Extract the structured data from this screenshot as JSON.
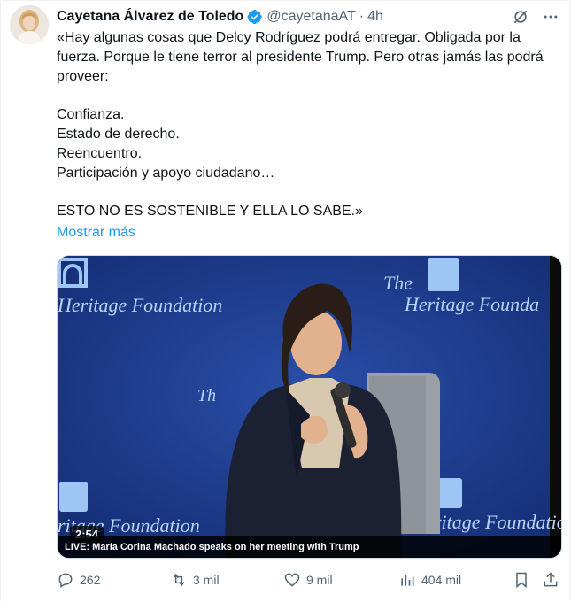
{
  "author": {
    "name": "Cayetana Álvarez de Toledo",
    "handle": "@cayetanaAT",
    "separator": "·",
    "time": "4h"
  },
  "tweet": {
    "text": "«Hay algunas cosas que Delcy Rodríguez podrá entregar. Obligada por la fuerza. Porque le tiene terror al presidente Trump. Pero otras jamás las podrá proveer:\n\nConfianza.\nEstado de derecho.\nReencuentro.\nParticipación y apoyo ciudadano…\n\nESTO NO ES SOSTENIBLE Y ELLA LO SABE.»",
    "show_more": "Mostrar más"
  },
  "media": {
    "duration": "2:54",
    "caption": "LIVE: María Corina Machado speaks on her meeting with Trump",
    "background_text_left": "Heritage Foundation",
    "background_text_right_top": "The",
    "background_text_right": "Heritage Founda",
    "background_text_mid": "Th",
    "background_text_bottom_left": "ritage Foundation",
    "background_text_bottom_right": "ritage Foundation",
    "background_text_top_left": "ritage Foundation"
  },
  "actions": {
    "replies": "262",
    "reposts": "3 mil",
    "likes": "9 mil",
    "views": "404 mil"
  },
  "colors": {
    "accent": "#1d9bf0",
    "muted": "#536471",
    "text": "#0f1419",
    "stage_blue": "#1c3a8c"
  },
  "icons": [
    "verified-icon",
    "grok-icon",
    "more-icon",
    "reply-icon",
    "repost-icon",
    "like-icon",
    "views-icon",
    "bookmark-icon",
    "share-icon"
  ]
}
